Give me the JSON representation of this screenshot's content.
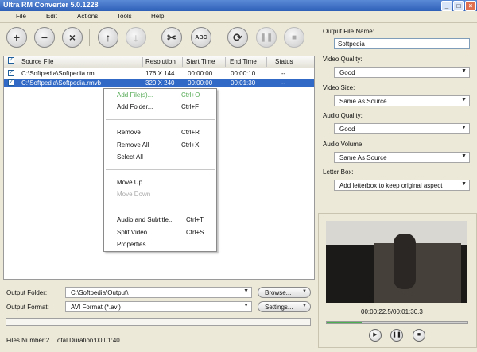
{
  "window": {
    "title": "Ultra RM Converter 5.0.1228",
    "minimize": "_",
    "maximize": "□",
    "close": "×"
  },
  "menu": [
    "File",
    "Edit",
    "Actions",
    "Tools",
    "Help"
  ],
  "toolbar": {
    "icons": [
      "add-file-icon",
      "remove-icon",
      "clear-icon",
      "move-up-icon",
      "move-down-icon",
      "split-icon",
      "subtitle-icon",
      "convert-icon",
      "pause-icon",
      "stop-icon"
    ],
    "subtitle_label": "ABC"
  },
  "file_list": {
    "headers": {
      "source": "Source File",
      "resolution": "Resolution",
      "start": "Start Time",
      "end": "End Time",
      "status": "Status"
    },
    "rows": [
      {
        "source": "C:\\Softpedia\\Softpedia.rm",
        "resolution": "176 X 144",
        "start": "00:00:00",
        "end": "00:00:10",
        "status": "--"
      },
      {
        "source": "C:\\Softpedia\\Softpedia.rmvb",
        "resolution": "320 X 240",
        "start": "00:00:00",
        "end": "00:01:30",
        "status": "--"
      }
    ]
  },
  "context_menu": {
    "add_files": {
      "label": "Add File(s)...",
      "shortcut": "Ctrl+O"
    },
    "add_folder": {
      "label": "Add Folder...",
      "shortcut": "Ctrl+F"
    },
    "remove": {
      "label": "Remove",
      "shortcut": "Ctrl+R"
    },
    "remove_all": {
      "label": "Remove All",
      "shortcut": "Ctrl+X"
    },
    "select_all": {
      "label": "Select All"
    },
    "move_up": {
      "label": "Move Up"
    },
    "move_down": {
      "label": "Move Down"
    },
    "audio_subtitle": {
      "label": "Audio and Subtitle...",
      "shortcut": "Ctrl+T"
    },
    "split_video": {
      "label": "Split Video...",
      "shortcut": "Ctrl+S"
    },
    "properties": {
      "label": "Properties..."
    }
  },
  "output": {
    "folder_label": "Output Folder:",
    "folder_value": "C:\\Softpedia\\Output\\",
    "browse": "Browse...",
    "format_label": "Output Format:",
    "format_value": "AVI Format (*.avi)",
    "settings": "Settings..."
  },
  "settings": {
    "file_name_label": "Output File Name:",
    "file_name_value": "Softpedia",
    "video_quality_label": "Video Quality:",
    "video_quality_value": "Good",
    "video_size_label": "Video Size:",
    "video_size_value": "Same As Source",
    "audio_quality_label": "Audio Quality:",
    "audio_quality_value": "Good",
    "audio_volume_label": "Audio Volume:",
    "audio_volume_value": "Same As Source",
    "letterbox_label": "Letter Box:",
    "letterbox_value": "Add letterbox to keep original aspect"
  },
  "preview": {
    "time": "00:00:22.5/00:01:30.3",
    "progress_fraction": 0.25
  },
  "status": {
    "files": "Files Number:2",
    "duration": "Total Duration:00:01:40"
  }
}
